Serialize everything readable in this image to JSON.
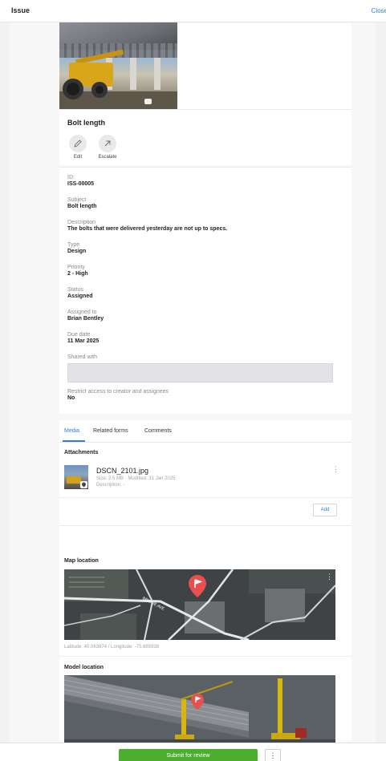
{
  "header": {
    "title": "Issue",
    "close_label": "Close"
  },
  "issue": {
    "title": "Bolt length",
    "actions": [
      {
        "label": "Edit",
        "icon": "pencil-icon"
      },
      {
        "label": "Escalate",
        "icon": "escalate-arrow-icon"
      }
    ]
  },
  "details": {
    "id_label": "ID:",
    "id_value": "ISS-00005",
    "subject_label": "Subject",
    "subject_value": "Bolt length",
    "description_label": "Description",
    "description_value": "The bolts that were delivered yesterday are not up to specs.",
    "type_label": "Type",
    "type_value": "Design",
    "priority_label": "Priority",
    "priority_value": "2 - High",
    "status_label": "Status",
    "status_value": "Assigned",
    "assigned_label": "Assigned to",
    "assigned_value": "Brian Bentley",
    "due_label": "Due date",
    "due_value": "11 Mar 2025",
    "shared_label": "Shared with",
    "restrict_label": "Restrict access to creator and assignees",
    "restrict_value": "No"
  },
  "tabs": [
    {
      "label": "Media",
      "active": true
    },
    {
      "label": "Related forms",
      "active": false
    },
    {
      "label": "Comments",
      "active": false
    }
  ],
  "attachments": {
    "title": "Attachments",
    "items": [
      {
        "name": "DSCN_2101.jpg",
        "meta": "Size: 2.5 MB · Modified: 31 Jan 2025",
        "description": "Description: -"
      }
    ],
    "add_label": "Add"
  },
  "map": {
    "title": "Map location",
    "coords": "Latitude: 40.063874 / Longitude: -75.685938",
    "road_label": "BRIDGE AVE"
  },
  "model": {
    "title": "Model location"
  },
  "footer": {
    "submit_label": "Submit for review",
    "more_label": "⋮"
  },
  "colors": {
    "accent": "#2f7ed8",
    "primary_button": "#4cae2e",
    "pin": "#e8504f"
  }
}
